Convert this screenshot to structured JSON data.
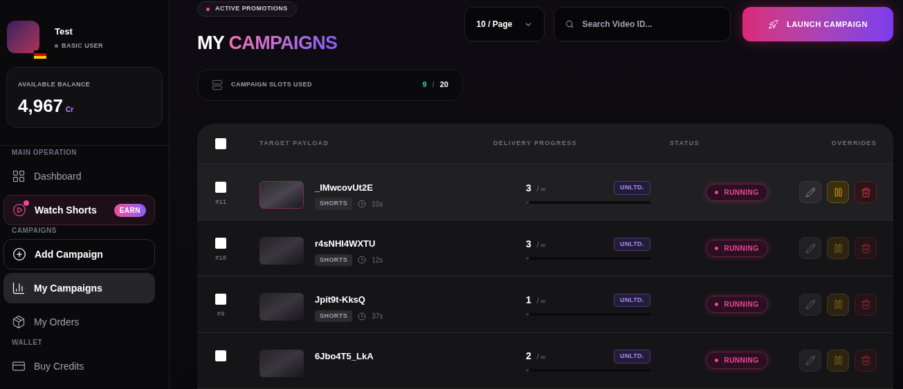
{
  "user": {
    "name": "Test",
    "role": "BASIC USER"
  },
  "balance": {
    "label": "AVAILABLE BALANCE",
    "amount": "4,967",
    "unit": "Cr"
  },
  "sidebar": {
    "sections": [
      {
        "title": "MAIN OPERATION",
        "items": [
          {
            "label": "Dashboard",
            "kind": "plain",
            "selected": false
          },
          {
            "label": "Watch Shorts",
            "kind": "promo",
            "badge": "EARN",
            "selected": false
          }
        ]
      },
      {
        "title": "CAMPAIGNS",
        "items": [
          {
            "label": "Add Campaign",
            "kind": "outlined",
            "selected": false
          },
          {
            "label": "My Campaigns",
            "kind": "plain",
            "selected": true
          },
          {
            "label": "My Orders",
            "kind": "plain",
            "selected": false
          }
        ]
      },
      {
        "title": "WALLET",
        "items": [
          {
            "label": "Buy Credits",
            "kind": "plain",
            "selected": false
          }
        ]
      }
    ]
  },
  "header": {
    "badge": "ACTIVE PROMOTIONS",
    "title_plain": "MY",
    "title_accent": "CAMPAIGNS",
    "page_size": "10 / Page",
    "search_placeholder": "Search Video ID...",
    "launch_button": "LAUNCH CAMPAIGN"
  },
  "slots": {
    "label": "CAMPAIGN SLOTS USED",
    "used": "9",
    "separator": "/",
    "total": "20"
  },
  "table": {
    "columns": [
      "TARGET PAYLOAD",
      "DELIVERY PROGRESS",
      "STATUS",
      "OVERRIDES"
    ],
    "all_checked": false,
    "rows": [
      {
        "id": "#11",
        "title": "_IMwcovUt2E",
        "tag": "SHORTS",
        "duration": "10s",
        "count": "3",
        "limit": "/ ∞",
        "plan": "UNLTD.",
        "level": 0.02,
        "status": "RUNNING",
        "checked": false,
        "highlighted": true
      },
      {
        "id": "#10",
        "title": "r4sNHI4WXTU",
        "tag": "SHORTS",
        "duration": "12s",
        "count": "3",
        "limit": "/ ∞",
        "plan": "UNLTD.",
        "level": 0.02,
        "status": "RUNNING",
        "checked": false,
        "highlighted": false
      },
      {
        "id": "#9",
        "title": "Jpit9t-KksQ",
        "tag": "SHORTS",
        "duration": "37s",
        "count": "1",
        "limit": "/ ∞",
        "plan": "UNLTD.",
        "level": 0.02,
        "status": "RUNNING",
        "checked": false,
        "highlighted": false
      },
      {
        "title": "6Jbo4T5_LkA",
        "count": "2",
        "limit": "/ ∞",
        "plan": "UNLTD.",
        "level": 0.02,
        "status": "RUNNING",
        "checked": false,
        "highlighted": false
      }
    ]
  }
}
